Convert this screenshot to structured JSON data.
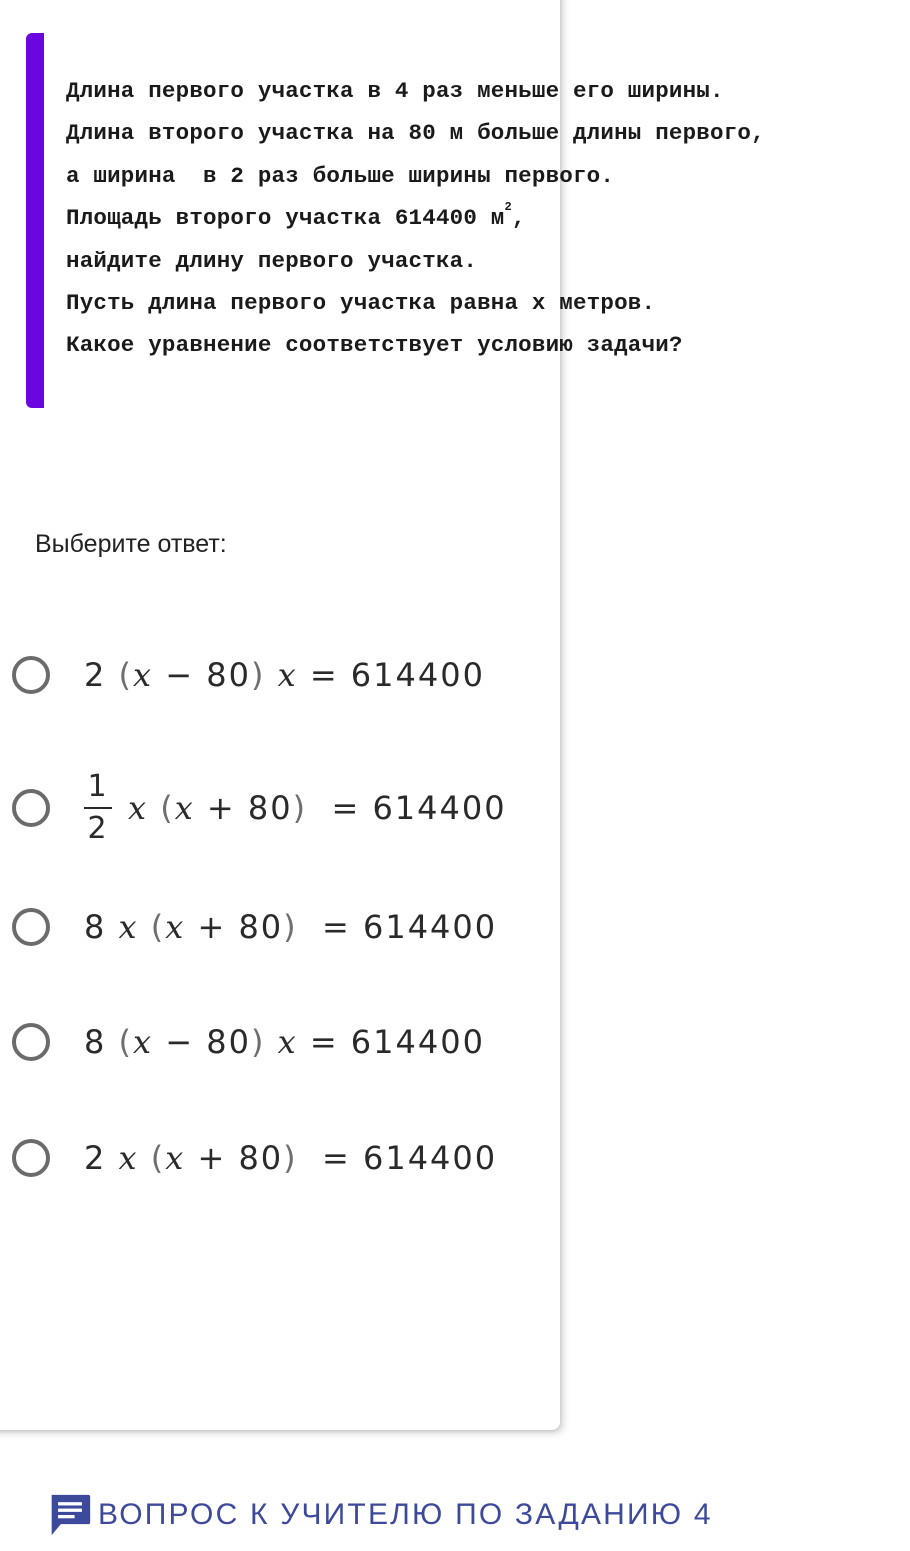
{
  "problem": {
    "lines": [
      "Длина первого участка в 4 раз меньше его ширины.",
      "Длина второго участка на 80 м больше длины первого,",
      "а ширина  в 2 раз больше ширины первого.",
      "Площадь второго участка 614400 м",
      "найдите длину первого участка.",
      "Пусть длина первого участка равна x метров.",
      "Какое уравнение соответствует условию задачи?"
    ],
    "area_superscript": "2",
    "area_suffix": ","
  },
  "prompt": "Выберите ответ:",
  "options": [
    {
      "parts": [
        "2 ",
        "(",
        "x",
        " − 80",
        ")",
        " x",
        " = 614400"
      ]
    },
    {
      "fraction": {
        "num": "1",
        "den": "2"
      },
      "parts": [
        "x",
        " ",
        "(",
        "x",
        " + 80",
        ")",
        "  = 614400"
      ]
    },
    {
      "parts": [
        "8 ",
        "x",
        " ",
        "(",
        "x",
        " + 80",
        ")",
        "  = 614400"
      ]
    },
    {
      "parts": [
        "8 ",
        "(",
        "x",
        " − 80",
        ")",
        " x",
        " = 614400"
      ]
    },
    {
      "parts": [
        "2 ",
        "x",
        " ",
        "(",
        "x",
        " + 80",
        ")",
        "  = 614400"
      ]
    }
  ],
  "footer": {
    "label": "ВОПРОС К УЧИТЕЛЮ ПО ЗАДАНИЮ 4",
    "icon": "chat-bubble-icon"
  },
  "colors": {
    "accent": "#6a06e0",
    "footer_text": "#3d4a9c",
    "radio_border": "#6b6b6b"
  }
}
